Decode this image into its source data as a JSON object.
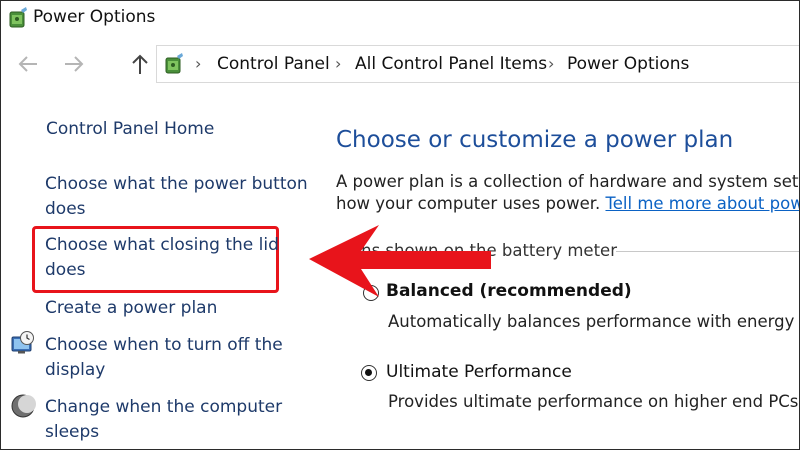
{
  "window": {
    "title": "Power Options"
  },
  "breadcrumb": [
    "Control Panel",
    "All Control Panel Items",
    "Power Options"
  ],
  "sidebar": {
    "home": "Control Panel Home",
    "items": [
      {
        "line1": "Choose what the power button",
        "line2": "does"
      },
      {
        "line1": "Choose what closing the lid",
        "line2": "does"
      },
      {
        "line1": "Create a power plan"
      },
      {
        "line1": "Choose when to turn off the",
        "line2": "display",
        "icon": "monitor-clock-icon"
      },
      {
        "line1": "Change when the computer",
        "line2": "sleeps",
        "icon": "moon-icon"
      }
    ]
  },
  "main": {
    "heading": "Choose or customize a power plan",
    "desc_line1": "A power plan is a collection of hardware and system setting",
    "desc_line2": "how your computer uses power.",
    "desc_link": "Tell me more about powe",
    "group_label": "ans shown on the battery meter",
    "plans": [
      {
        "name": "Balanced (recommended)",
        "description": "Automatically balances performance with energy co",
        "selected": false
      },
      {
        "name": "Ultimate Performance",
        "description": "Provides ultimate performance on higher end PCs.",
        "selected": true
      }
    ]
  },
  "annotation": {
    "highlight_color": "#e8141b",
    "arrow_color": "#e8141b"
  }
}
